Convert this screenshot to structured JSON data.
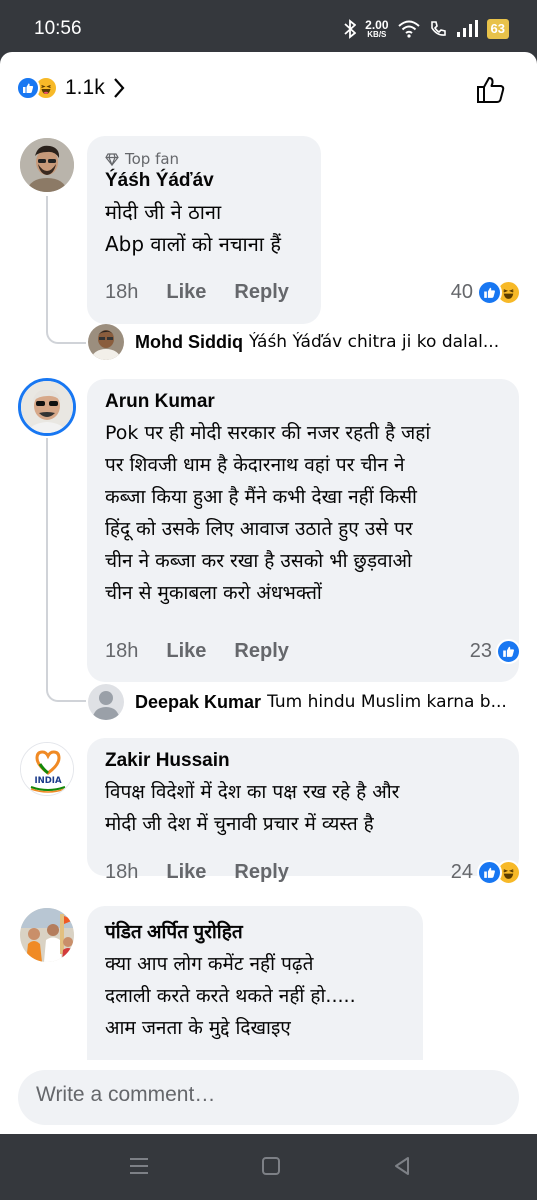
{
  "status": {
    "time": "10:56",
    "speed_value": "2.00",
    "speed_unit": "KB/S",
    "battery": "63"
  },
  "header": {
    "reaction_count": "1.1k"
  },
  "comments": [
    {
      "badge": "Top fan",
      "author": "Ýáśh Ýáďáv",
      "lines": [
        "मोदी जी ने ठाना",
        "Abp वालों को नचाना हैं"
      ],
      "time": "18h",
      "like": "Like",
      "reply": "Reply",
      "reactions": "40",
      "reply_preview": {
        "author": "Mohd Siddiq",
        "text": "Ýáśh Ýáďáv chitra ji ko dalal..."
      }
    },
    {
      "author": "Arun Kumar",
      "lines": [
        "Pok पर ही मोदी सरकार की नजर रहती है जहां",
        "पर शिवजी धाम है केदारनाथ वहां पर चीन ने",
        "कब्जा किया हुआ है मैंने कभी देखा नहीं किसी",
        "हिंदू को उसके लिए आवाज उठाते हुए उसे पर",
        "चीन ने कब्जा कर रखा है उसको भी छुड़वाओ",
        "चीन से मुकाबला करो अंधभक्तों"
      ],
      "time": "18h",
      "like": "Like",
      "reply": "Reply",
      "reactions": "23",
      "reply_preview": {
        "author": "Deepak Kumar",
        "text": "Tum hindu Muslim karna b..."
      }
    },
    {
      "author": "Zakir Hussain",
      "avatar_text": "INDIA",
      "lines": [
        "विपक्ष विदेशों में देश का पक्ष रख रहे है और",
        "मोदी जी देश में चुनावी प्रचार में व्यस्त है"
      ],
      "time": "18h",
      "like": "Like",
      "reply": "Reply",
      "reactions": "24"
    },
    {
      "author": "पंडित अर्पित पुरोहित",
      "lines": [
        "क्या आप लोग कमेंट नहीं पढ़ते",
        "दलाली करते करते थकते नहीं हो.....",
        "आम जनता के मुद्दे दिखाइए"
      ]
    }
  ],
  "composer": {
    "placeholder": "Write a comment…"
  },
  "colors": {
    "like_blue": "#1877f2",
    "haha_yellow": "#f7b928",
    "bubble": "#f0f2f5",
    "secondary_text": "#65676b",
    "system_bar": "#35383d"
  }
}
